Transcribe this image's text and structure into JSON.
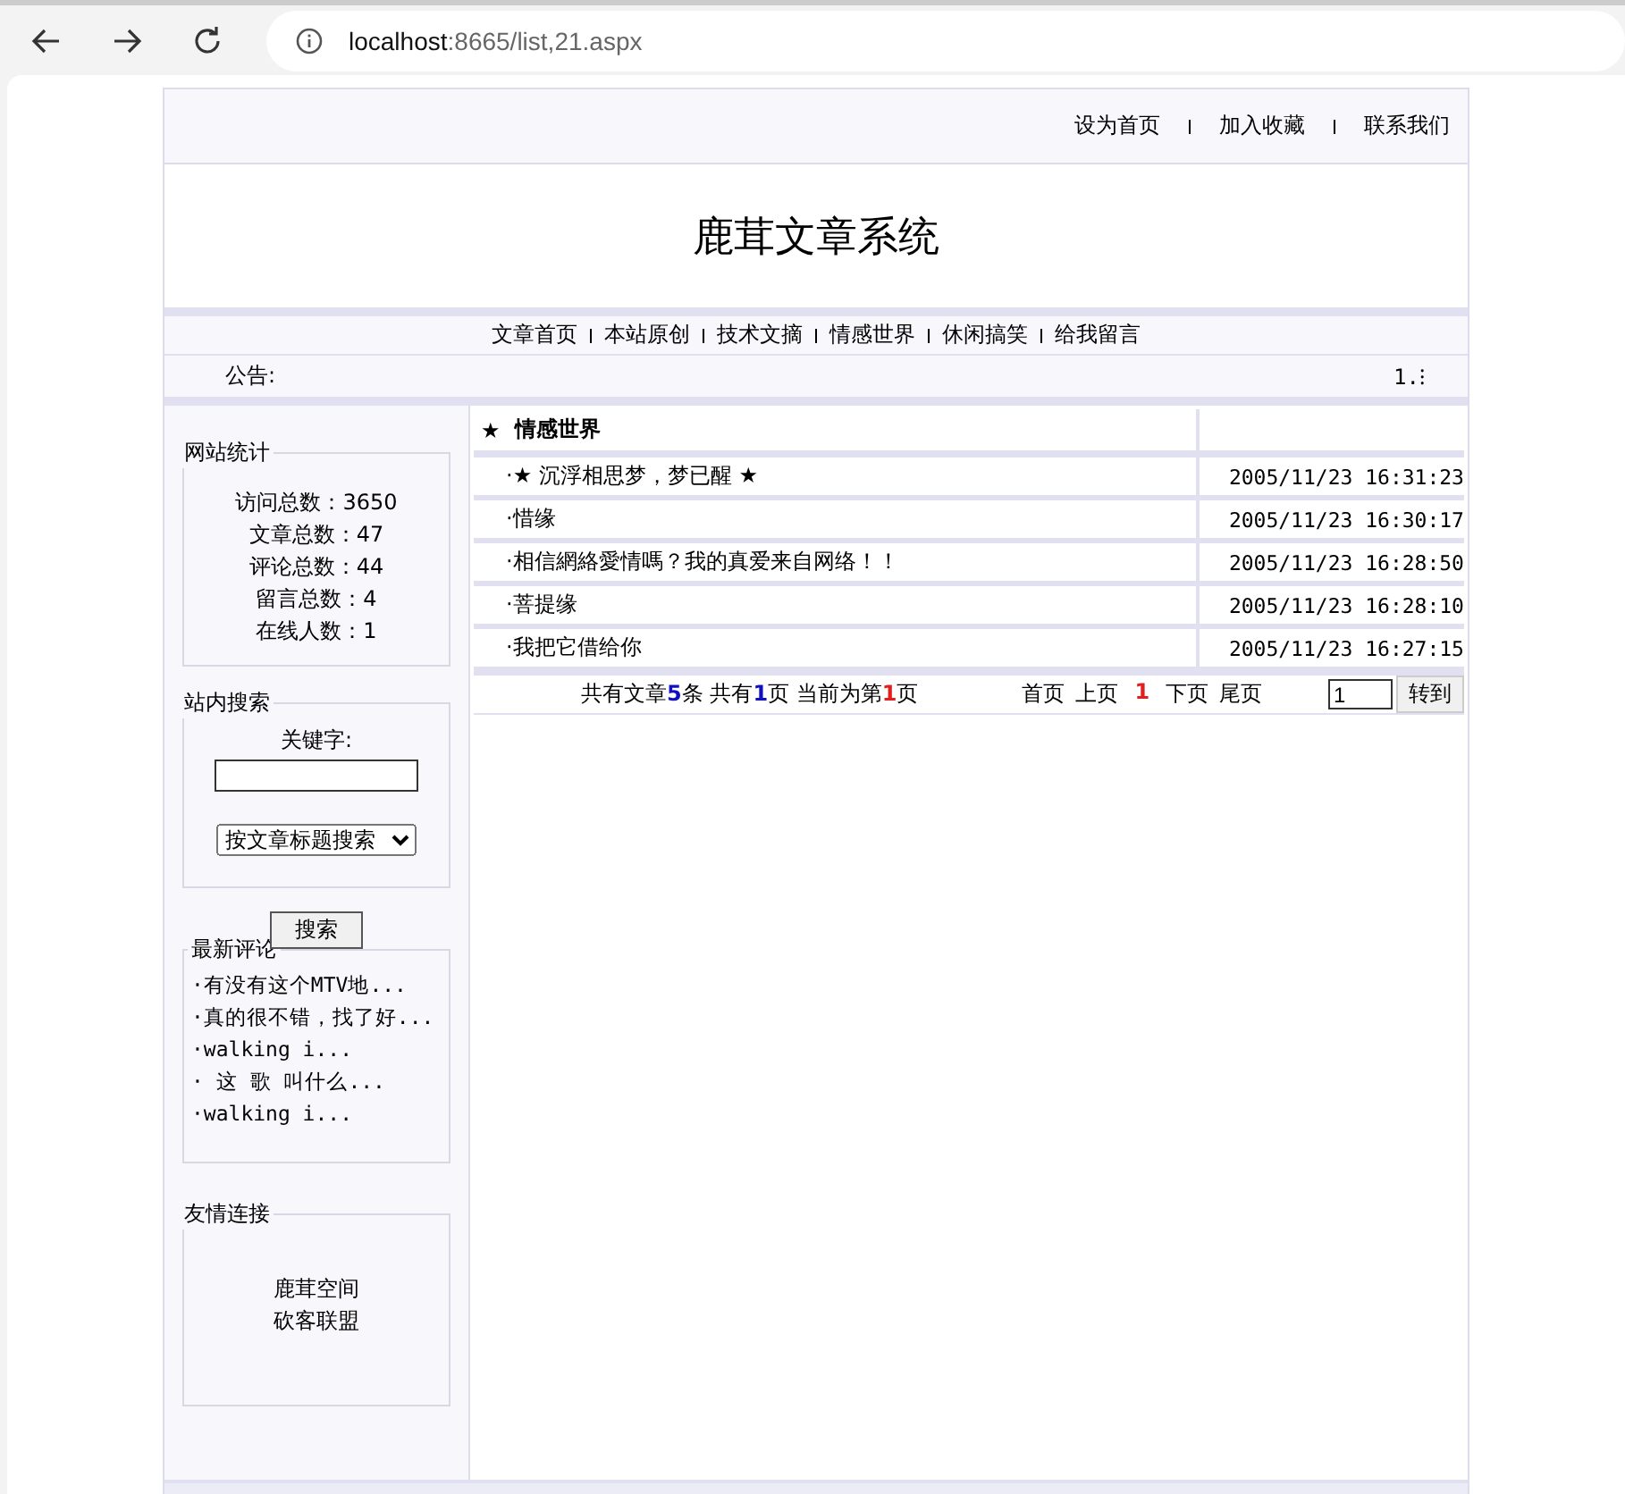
{
  "browser": {
    "url_host": "localhost",
    "url_rest": ":8665/list,21.aspx"
  },
  "top_links": [
    "设为首页",
    "加入收藏",
    "联系我们"
  ],
  "site_title": "鹿茸文章系统",
  "nav": [
    "文章首页",
    "本站原创",
    "技术文摘",
    "情感世界",
    "休闲搞笑",
    "给我留言"
  ],
  "notice": {
    "label": "公告:",
    "text": "1.⁝"
  },
  "stats": {
    "title": "网站统计",
    "lines": [
      "访问总数：3650",
      "文章总数：47",
      "评论总数：44",
      "留言总数：4",
      "在线人数：1"
    ]
  },
  "search": {
    "title": "站内搜索",
    "keyword_label": "关键字:",
    "scope": "按文章标题搜索",
    "button": "搜索"
  },
  "comments": {
    "title": "最新评论",
    "items": [
      "·有没有这个MTV地...",
      "·真的很不错，找了好...",
      "·walking i...",
      "· 这 歌 叫什么...",
      "·walking i..."
    ]
  },
  "friends": {
    "title": "友情连接",
    "items": [
      "鹿茸空间",
      "砍客联盟"
    ]
  },
  "category": {
    "star": "★",
    "title": "情感世界"
  },
  "articles": [
    {
      "title": "·★ 沉浮相思梦，梦已醒 ★",
      "date": "2005/11/23 16:31:23"
    },
    {
      "title": "·惜缘",
      "date": "2005/11/23 16:30:17"
    },
    {
      "title": "·相信網絡愛情嗎？我的真爱来自网络！！",
      "date": "2005/11/23 16:28:50"
    },
    {
      "title": "·菩提缘",
      "date": "2005/11/23 16:28:10"
    },
    {
      "title": "·我把它借给你",
      "date": "2005/11/23 16:27:15"
    }
  ],
  "pager": {
    "summary": [
      {
        "text": "共有文章",
        "kind": "plain"
      },
      {
        "text": "5",
        "kind": "count"
      },
      {
        "text": "条 共有",
        "kind": "plain"
      },
      {
        "text": "1",
        "kind": "count"
      },
      {
        "text": "页 当前为第",
        "kind": "plain"
      },
      {
        "text": "1",
        "kind": "current"
      },
      {
        "text": "页",
        "kind": "plain"
      }
    ],
    "links": [
      {
        "text": "首页",
        "kind": "link"
      },
      {
        "text": "上页",
        "kind": "link"
      },
      {
        "text": "1",
        "kind": "current"
      },
      {
        "text": "下页",
        "kind": "link"
      },
      {
        "text": "尾页",
        "kind": "link"
      }
    ],
    "page_value": "1",
    "go_button": "转到"
  }
}
